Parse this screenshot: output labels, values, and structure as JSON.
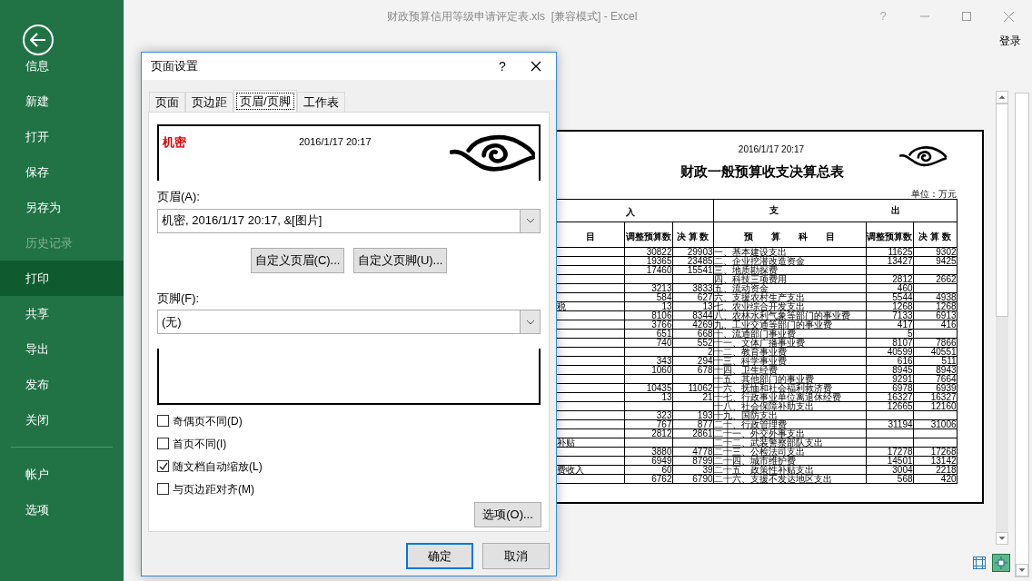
{
  "window": {
    "title": "财政预算信用等级申请评定表.xls  [兼容模式] - Excel",
    "help": "?",
    "sign_in": "登录"
  },
  "backstage": {
    "items": [
      {
        "label": "信息",
        "selected": false,
        "disabled": false
      },
      {
        "label": "新建",
        "selected": false,
        "disabled": false
      },
      {
        "label": "打开",
        "selected": false,
        "disabled": false
      },
      {
        "label": "保存",
        "selected": false,
        "disabled": false
      },
      {
        "label": "另存为",
        "selected": false,
        "disabled": false
      },
      {
        "label": "历史记录",
        "selected": false,
        "disabled": true
      },
      {
        "label": "打印",
        "selected": true,
        "disabled": false
      },
      {
        "label": "共享",
        "selected": false,
        "disabled": false
      },
      {
        "label": "导出",
        "selected": false,
        "disabled": false
      },
      {
        "label": "发布",
        "selected": false,
        "disabled": false
      },
      {
        "label": "关闭",
        "selected": false,
        "disabled": false
      }
    ],
    "bottom_items": [
      {
        "label": "帐户",
        "selected": false,
        "disabled": false
      },
      {
        "label": "选项",
        "selected": false,
        "disabled": false
      }
    ]
  },
  "dialog": {
    "title": "页面设置",
    "help": "?",
    "tabs": [
      {
        "label": "页面",
        "selected": false
      },
      {
        "label": "页边距",
        "selected": false
      },
      {
        "label": "页眉/页脚",
        "selected": true
      },
      {
        "label": "工作表",
        "selected": false
      }
    ],
    "header_preview": {
      "left": "机密",
      "center": "2016/1/17 20:17"
    },
    "header_label": "页眉(A):",
    "header_value": "机密, 2016/1/17 20:17, &[图片]",
    "custom_buttons": [
      "自定义页眉(C)...",
      "自定义页脚(U)..."
    ],
    "footer_label": "页脚(F):",
    "footer_value": "(无)",
    "checkboxes": [
      {
        "label": "奇偶页不同(D)",
        "checked": false
      },
      {
        "label": "首页不同(I)",
        "checked": false
      },
      {
        "label": "随文档自动缩放(L)",
        "checked": true
      },
      {
        "label": "与页边距对齐(M)",
        "checked": false
      }
    ],
    "options_button": "选项(O)...",
    "ok": "确定",
    "cancel": "取消"
  },
  "preview": {
    "date": "2016/1/17 20:17",
    "title": "财政一般预算收支决算总表",
    "unit": "单位：万元",
    "group_headers": [
      "入",
      "支",
      "出"
    ],
    "columns": [
      "目",
      "调整预算数",
      "决 算 数",
      "预　　算　　科　　目",
      "调整预算数",
      "决 算 数"
    ],
    "rows": [
      {
        "in_budget": "30822",
        "in_final": "29903",
        "out_item": "一、基本建设支出",
        "out_budget": "11625",
        "out_final": "9302"
      },
      {
        "in_budget": "19365",
        "in_final": "23485",
        "out_item": "二、企业挖潜改造资金",
        "out_budget": "13427",
        "out_final": "9425"
      },
      {
        "in_budget": "17460",
        "in_final": "15541",
        "out_item": "三、地质勘探费"
      },
      {
        "out_item": "四、科技三项费用",
        "out_budget": "2812",
        "out_final": "2662"
      },
      {
        "in_budget": "3213",
        "in_final": "3833",
        "out_item": "五、流动资金",
        "out_budget": "460"
      },
      {
        "in_budget": "584",
        "in_final": "627",
        "out_item": "六、支援农村生产支出",
        "out_budget": "5544",
        "out_final": "4938"
      },
      {
        "item_cut": "税",
        "in_budget": "13",
        "in_final": "13",
        "out_item": "七、农业综合开发支出",
        "out_budget": "1268",
        "out_final": "1268"
      },
      {
        "in_budget": "8106",
        "in_final": "8344",
        "out_item": "八、农林水利气象等部门的事业费",
        "out_budget": "7133",
        "out_final": "6913"
      },
      {
        "in_budget": "3766",
        "in_final": "4269",
        "out_item": "九、工业交通等部门的事业费",
        "out_budget": "417",
        "out_final": "416"
      },
      {
        "in_budget": "651",
        "in_final": "668",
        "out_item": "十、流通部门事业费",
        "out_budget": "5"
      },
      {
        "in_budget": "740",
        "in_final": "552",
        "out_item": "十一、文体广播事业费",
        "out_budget": "8107",
        "out_final": "7866"
      },
      {
        "in_final": "2",
        "out_item": "十二、教育事业费",
        "out_budget": "40599",
        "out_final": "40551"
      },
      {
        "in_budget": "343",
        "in_final": "294",
        "out_item": "十三、科学事业费",
        "out_budget": "616",
        "out_final": "511"
      },
      {
        "in_budget": "1060",
        "in_final": "678",
        "out_item": "十四、卫生经费",
        "out_budget": "8945",
        "out_final": "8943"
      },
      {
        "out_item": "十五、其他部门的事业费",
        "out_budget": "9291",
        "out_final": "7664"
      },
      {
        "in_budget": "10435",
        "in_final": "11062",
        "out_item": "十六、抚恤和社会福利救济费",
        "out_budget": "6978",
        "out_final": "6939"
      },
      {
        "in_budget": "13",
        "in_final": "21",
        "out_item": "十七、行政事业单位离退休经费",
        "out_budget": "16327",
        "out_final": "16327"
      },
      {
        "out_item": "十八、社会保障补助支出",
        "out_budget": "12665",
        "out_final": "12160"
      },
      {
        "in_budget": "323",
        "in_final": "193",
        "out_item": "十九、国防支出"
      },
      {
        "in_budget": "767",
        "in_final": "877",
        "out_item": "二十、行政管理费",
        "out_budget": "31194",
        "out_final": "31006"
      },
      {
        "in_budget": "2812",
        "in_final": "2861",
        "out_item": "二十一、外交外事支出"
      },
      {
        "item_cut": "补贴",
        "out_item": "二十二、武装警察部队支出"
      },
      {
        "in_budget": "3880",
        "in_final": "4778",
        "out_item": "二十三、公检法司支出",
        "out_budget": "17278",
        "out_final": "17268"
      },
      {
        "in_budget": "6949",
        "in_final": "8799",
        "out_item": "二十四、城市维护费",
        "out_budget": "14501",
        "out_final": "13142"
      },
      {
        "item_cut": "费收入",
        "in_budget": "60",
        "in_final": "39",
        "out_item": "二十五、政策性补贴支出",
        "out_budget": "3004",
        "out_final": "2218"
      },
      {
        "in_budget": "6762",
        "in_final": "6790",
        "out_item": "二十六、支援不发达地区支出",
        "out_budget": "568",
        "out_final": "420"
      }
    ]
  }
}
